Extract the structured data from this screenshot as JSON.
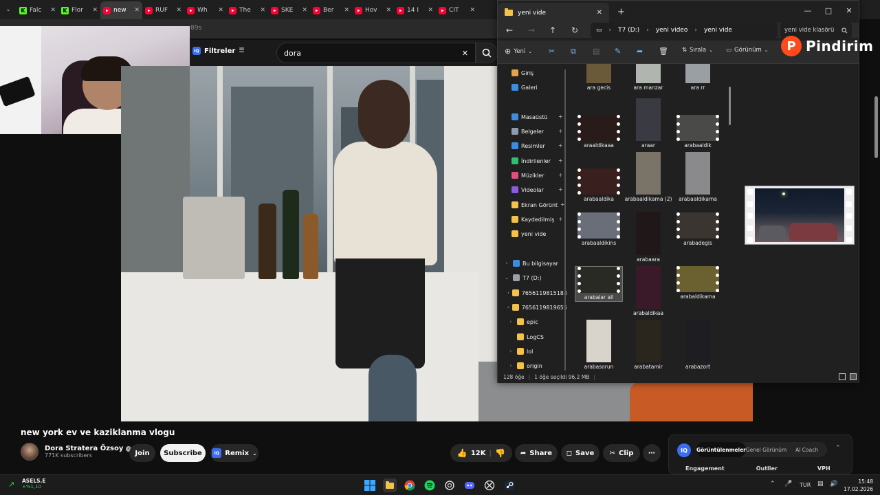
{
  "browser": {
    "tabs": [
      {
        "icon": "kick",
        "title": "Falc"
      },
      {
        "icon": "kick",
        "title": "Flor"
      },
      {
        "icon": "youtube",
        "title": "new",
        "active": true
      },
      {
        "icon": "youtube",
        "title": "RÜF"
      },
      {
        "icon": "youtube",
        "title": "Wh"
      },
      {
        "icon": "youtube",
        "title": "The"
      },
      {
        "icon": "youtube",
        "title": "SKE"
      },
      {
        "icon": "youtube",
        "title": "Ber"
      },
      {
        "icon": "youtube",
        "title": "Hov"
      },
      {
        "icon": "youtube",
        "title": "14 I"
      },
      {
        "icon": "youtube",
        "title": "CIT"
      }
    ],
    "url_fragment": "89s"
  },
  "filters": {
    "label": "Filtreler",
    "badge": "IQ",
    "search_value": "dora"
  },
  "explorer": {
    "tab_title": "yeni vide",
    "new_tab": "+",
    "breadcrumbs": [
      "T7 (D:)",
      "yeni video",
      "yeni vide"
    ],
    "search_placeholder": "yeni vide klasörü",
    "toolbar": {
      "new": "Yeni",
      "sort": "Sırala",
      "view": "Görünüm"
    },
    "sidebar": [
      {
        "label": "Giriş",
        "color": "#e8a14a",
        "pinned": false
      },
      {
        "label": "Galeri",
        "color": "#3c8de0",
        "pinned": false
      },
      {
        "label": "Masaüstü",
        "color": "#3c8de0",
        "pinned": true
      },
      {
        "label": "Belgeler",
        "color": "#8e9aae",
        "pinned": true
      },
      {
        "label": "Resimler",
        "color": "#3c8de0",
        "pinned": true
      },
      {
        "label": "İndirilenler",
        "color": "#2fbf71",
        "pinned": true
      },
      {
        "label": "Müzikler",
        "color": "#e0507a",
        "pinned": true
      },
      {
        "label": "Videolar",
        "color": "#8a5ce0",
        "pinned": true
      },
      {
        "label": "Ekran Görünt",
        "color": "#f4c14a",
        "pinned": true
      },
      {
        "label": "Kaydedilmiş",
        "color": "#f4c14a",
        "pinned": true
      },
      {
        "label": "yeni vide",
        "color": "#f4c14a",
        "pinned": false
      },
      {
        "label": "Bu bilgisayar",
        "color": "#3c8de0",
        "pinned": false
      },
      {
        "label": "T7 (D:)",
        "color": "#9aa0a6",
        "pinned": false
      },
      {
        "label": "76561198151836694",
        "color": "#f4c14a",
        "pinned": false
      },
      {
        "label": "76561198196553",
        "color": "#f4c14a",
        "pinned": false
      },
      {
        "label": "epic",
        "color": "#f4c14a",
        "pinned": false
      },
      {
        "label": "LogCS",
        "color": "#f4c14a",
        "pinned": false
      },
      {
        "label": "lol",
        "color": "#f4c14a",
        "pinned": false
      },
      {
        "label": "origin",
        "color": "#f4c14a",
        "pinned": false
      }
    ],
    "files": [
      {
        "name": "ara gecis"
      },
      {
        "name": "ara manzar"
      },
      {
        "name": "ara rr"
      },
      {
        "name": "araaldikaaa"
      },
      {
        "name": "araar"
      },
      {
        "name": "arabaaldik"
      },
      {
        "name": "arabaaldika"
      },
      {
        "name": "arabaaldikama (2)"
      },
      {
        "name": "arabaaldikama"
      },
      {
        "name": "arabaaldikins"
      },
      {
        "name": "arabaara"
      },
      {
        "name": "arabadegis"
      },
      {
        "name": "arabalar all"
      },
      {
        "name": "arabaldikaa"
      },
      {
        "name": "arabaldikama"
      },
      {
        "name": "arabasorun"
      },
      {
        "name": "arabatamir"
      },
      {
        "name": "arabazort"
      }
    ],
    "status": {
      "count": "128 öğe",
      "selection": "1 öğe seçildi  96,2 MB"
    }
  },
  "logo": {
    "letter": "P",
    "text": "Pindirim"
  },
  "video": {
    "title": "new york ev ve kaziklanma vlogu",
    "channel": "Dora Stratera Özsoy",
    "subscribers": "771K subscribers",
    "join": "Join",
    "subscribe": "Subscribe",
    "remix": "Remix",
    "likes": "12K",
    "share": "Share",
    "save": "Save",
    "clip": "Clip"
  },
  "iq_panel": {
    "badge": "IQ",
    "tabs": [
      "Görüntülenmeler",
      "Genel Görünüm",
      "AI Coach"
    ],
    "columns": [
      "Engagement",
      "Outlier",
      "VPH"
    ]
  },
  "taskbar": {
    "stock_name": "ASELS.E",
    "stock_change": "+%1,10",
    "language": "TUR",
    "time": "15:48",
    "date": "17.02.2026"
  }
}
